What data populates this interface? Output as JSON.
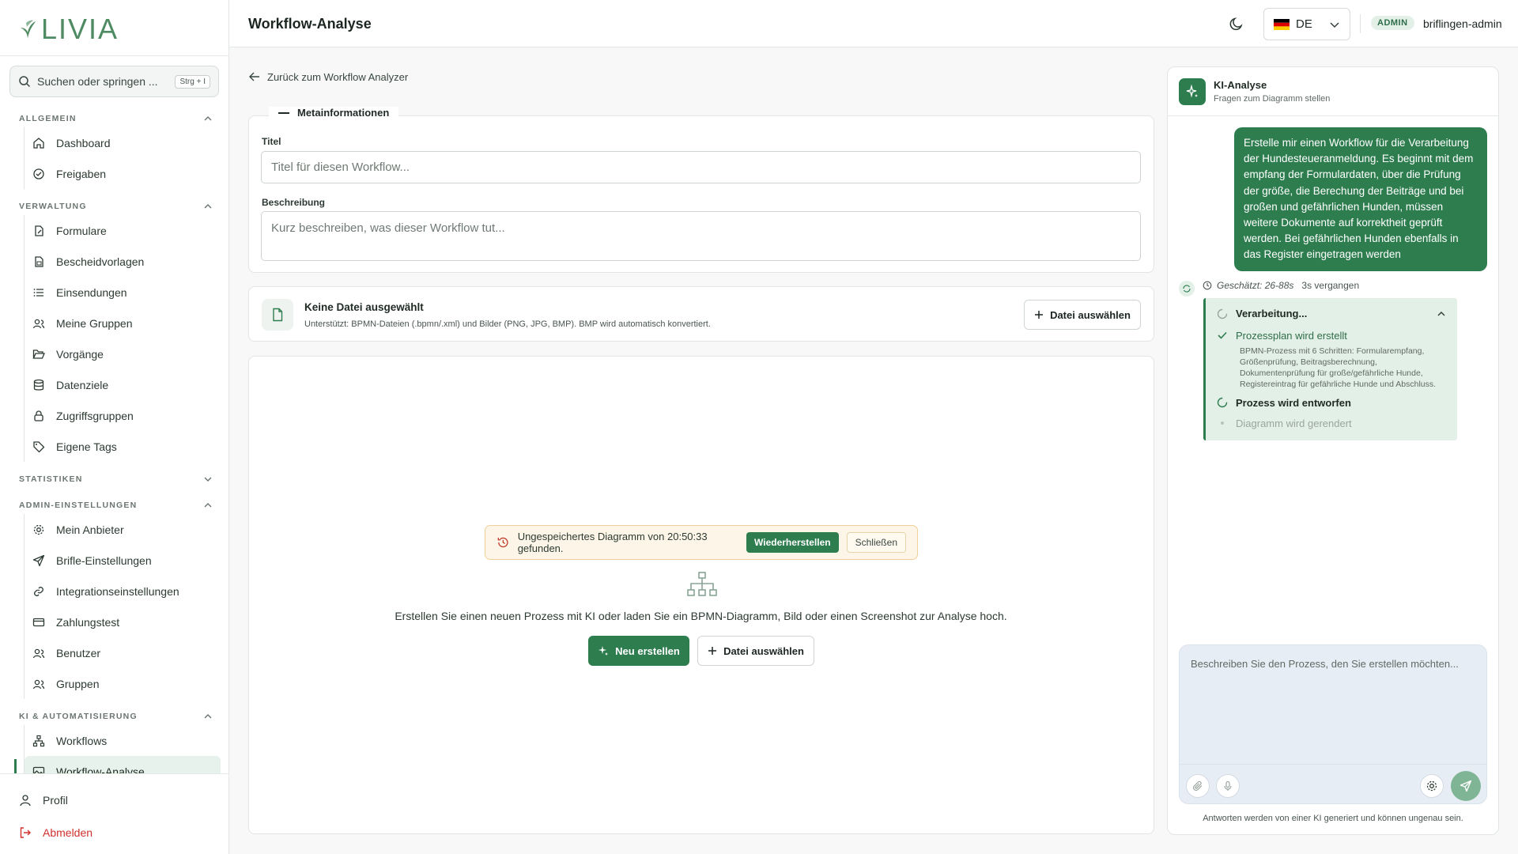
{
  "brand": {
    "name": "LIVIA"
  },
  "search": {
    "label": "Suchen oder springen ...",
    "shortcut": "Strg + I"
  },
  "sidebar": {
    "sections": [
      {
        "title": "ALLGEMEIN",
        "items": [
          {
            "label": "Dashboard"
          },
          {
            "label": "Freigaben"
          }
        ]
      },
      {
        "title": "VERWALTUNG",
        "items": [
          {
            "label": "Formulare"
          },
          {
            "label": "Bescheidvorlagen"
          },
          {
            "label": "Einsendungen"
          },
          {
            "label": "Meine Gruppen"
          },
          {
            "label": "Vorgänge"
          },
          {
            "label": "Datenziele"
          },
          {
            "label": "Zugriffsgruppen"
          },
          {
            "label": "Eigene Tags"
          }
        ]
      },
      {
        "title": "STATISTIKEN",
        "items": []
      },
      {
        "title": "ADMIN-EINSTELLUNGEN",
        "items": [
          {
            "label": "Mein Anbieter"
          },
          {
            "label": "Brifle-Einstellungen"
          },
          {
            "label": "Integrationseinstellungen"
          },
          {
            "label": "Zahlungstest"
          },
          {
            "label": "Benutzer"
          },
          {
            "label": "Gruppen"
          }
        ]
      },
      {
        "title": "KI & AUTOMATISIERUNG",
        "items": [
          {
            "label": "Workflows"
          },
          {
            "label": "Workflow-Analyse"
          }
        ]
      }
    ],
    "bottom": {
      "profile": "Profil",
      "logout": "Abmelden"
    }
  },
  "header": {
    "title": "Workflow-Analyse",
    "language": "DE",
    "role_badge": "ADMIN",
    "username": "briflingen-admin"
  },
  "main": {
    "back_link": "Zurück zum Workflow Analyzer",
    "meta": {
      "legend": "Metainformationen",
      "title_label": "Titel",
      "title_placeholder": "Titel für diesen Workflow...",
      "desc_label": "Beschreibung",
      "desc_placeholder": "Kurz beschreiben, was dieser Workflow tut..."
    },
    "file": {
      "title": "Keine Datei ausgewählt",
      "subtitle": "Unterstützt: BPMN-Dateien (.bpmn/.xml) und Bilder (PNG, JPG, BMP). BMP wird automatisch konvertiert.",
      "button": "Datei auswählen"
    },
    "canvas": {
      "banner_text": "Ungespeichertes Diagramm von 20:50:33 gefunden.",
      "restore": "Wiederherstellen",
      "close": "Schließen",
      "empty_text": "Erstellen Sie einen neuen Prozess mit KI oder laden Sie ein BPMN-Diagramm, Bild oder einen Screenshot zur Analyse hoch.",
      "new_button": "Neu erstellen",
      "file_button": "Datei auswählen"
    }
  },
  "ai_panel": {
    "title": "KI-Analyse",
    "subtitle": "Fragen zum Diagramm stellen",
    "user_message": "Erstelle mir einen Workflow für die Verarbeitung der Hundesteueranmeldung. Es beginnt mit dem empfang der Formulardaten, über die Prüfung der größe, die Berechung der Beiträge und bei großen und gefährlichen Hunden, müssen weitere Dokumente auf korrektheit geprüft werden. Bei gefährlichen Hunden ebenfalls in das Register eingetragen werden",
    "estimate": "Geschätzt: 26-88s",
    "elapsed": "3s vergangen",
    "processing": {
      "title": "Verarbeitung...",
      "steps": [
        {
          "label": "Prozessplan wird erstellt",
          "detail": "BPMN-Prozess mit 6 Schritten: Formularempfang, Größenprüfung, Beitragsberechnung, Dokumentenprüfung für große/gefährliche Hunde, Registereintrag für gefährliche Hunde und Abschluss.",
          "state": "done"
        },
        {
          "label": "Prozess wird entworfen",
          "state": "active"
        },
        {
          "label": "Diagramm wird gerendert",
          "state": "pending"
        }
      ]
    },
    "input_placeholder": "Beschreiben Sie den Prozess, den Sie erstellen möchten...",
    "disclaimer": "Antworten werden von einer KI generiert und können ungenau sein."
  },
  "colors": {
    "accent": "#2e7d4f",
    "warning_bg": "#fdf6e8",
    "danger": "#d0312d"
  }
}
